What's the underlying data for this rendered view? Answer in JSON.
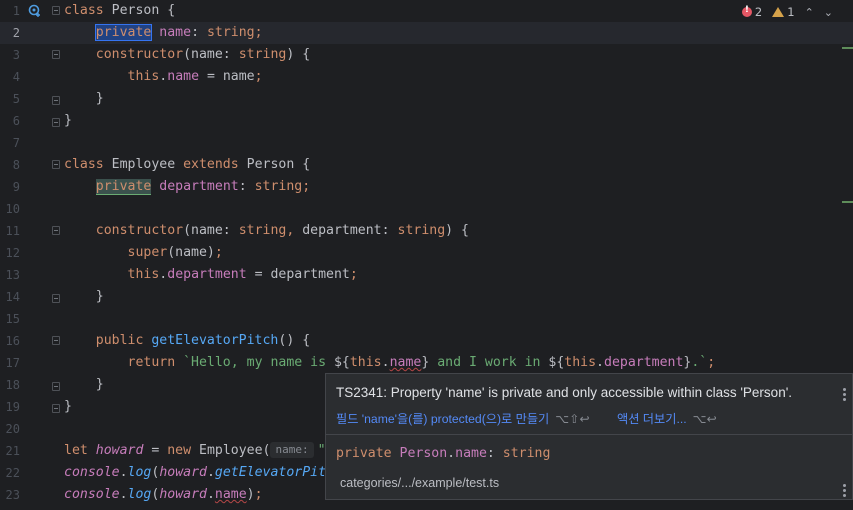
{
  "status": {
    "errors": "2",
    "warnings": "1"
  },
  "lines": [
    {
      "n": "1",
      "tokens": [
        [
          "kw",
          "class"
        ],
        [
          "tp",
          " Person {"
        ]
      ]
    },
    {
      "n": "2",
      "tokens": [
        [
          "tp",
          "    "
        ],
        [
          "sel",
          "private"
        ],
        [
          "kw",
          " "
        ],
        [
          "fld",
          "name"
        ],
        [
          "tp",
          ": "
        ],
        [
          "kw",
          "string"
        ],
        [
          "kw",
          ";"
        ]
      ]
    },
    {
      "n": "3",
      "tokens": [
        [
          "tp",
          "    "
        ],
        [
          "kw",
          "constructor"
        ],
        [
          "tp",
          "(name: "
        ],
        [
          "kw",
          "string"
        ],
        [
          "tp",
          ") {"
        ]
      ]
    },
    {
      "n": "4",
      "tokens": [
        [
          "tp",
          "        "
        ],
        [
          "kw",
          "this"
        ],
        [
          "tp",
          "."
        ],
        [
          "fld",
          "name"
        ],
        [
          "tp",
          " = name"
        ],
        [
          "kw",
          ";"
        ]
      ]
    },
    {
      "n": "5",
      "tokens": [
        [
          "tp",
          "    }"
        ]
      ]
    },
    {
      "n": "6",
      "tokens": [
        [
          "tp",
          "}"
        ]
      ]
    },
    {
      "n": "7",
      "tokens": []
    },
    {
      "n": "8",
      "tokens": [
        [
          "kw",
          "class"
        ],
        [
          "tp",
          " Employee "
        ],
        [
          "kw",
          "extends"
        ],
        [
          "tp",
          " Person {"
        ]
      ]
    },
    {
      "n": "9",
      "tokens": [
        [
          "tp",
          "    "
        ],
        [
          "warnbox",
          "private"
        ],
        [
          "kw",
          " "
        ],
        [
          "fld",
          "department"
        ],
        [
          "tp",
          ": "
        ],
        [
          "kw",
          "string"
        ],
        [
          "kw",
          ";"
        ]
      ]
    },
    {
      "n": "10",
      "tokens": []
    },
    {
      "n": "11",
      "tokens": [
        [
          "tp",
          "    "
        ],
        [
          "kw",
          "constructor"
        ],
        [
          "tp",
          "(name: "
        ],
        [
          "kw",
          "string"
        ],
        [
          "kw",
          ","
        ],
        [
          "tp",
          " department: "
        ],
        [
          "kw",
          "string"
        ],
        [
          "tp",
          ") {"
        ]
      ]
    },
    {
      "n": "12",
      "tokens": [
        [
          "tp",
          "        "
        ],
        [
          "kw",
          "super"
        ],
        [
          "tp",
          "(name)"
        ],
        [
          "kw",
          ";"
        ]
      ]
    },
    {
      "n": "13",
      "tokens": [
        [
          "tp",
          "        "
        ],
        [
          "kw",
          "this"
        ],
        [
          "tp",
          "."
        ],
        [
          "fld",
          "department"
        ],
        [
          "tp",
          " = department"
        ],
        [
          "kw",
          ";"
        ]
      ]
    },
    {
      "n": "14",
      "tokens": [
        [
          "tp",
          "    }"
        ]
      ]
    },
    {
      "n": "15",
      "tokens": []
    },
    {
      "n": "16",
      "tokens": [
        [
          "tp",
          "    "
        ],
        [
          "kw",
          "public "
        ],
        [
          "fn",
          "getElevatorPitch"
        ],
        [
          "tp",
          "() {"
        ]
      ]
    },
    {
      "n": "17",
      "tokens": [
        [
          "tp",
          "        "
        ],
        [
          "kw",
          "return "
        ],
        [
          "str",
          "`Hello, my name is "
        ],
        [
          "tp",
          "${"
        ],
        [
          "kw",
          "this"
        ],
        [
          "tp",
          "."
        ],
        [
          "fldw",
          "name"
        ],
        [
          "tp",
          "}"
        ],
        [
          "str",
          " and I work in "
        ],
        [
          "tp",
          "${"
        ],
        [
          "kw",
          "this"
        ],
        [
          "tp",
          "."
        ],
        [
          "fld",
          "department"
        ],
        [
          "tp",
          "}"
        ],
        [
          "str",
          ".`"
        ],
        [
          "kw",
          ";"
        ]
      ]
    },
    {
      "n": "18",
      "tokens": [
        [
          "tp",
          "    }"
        ]
      ]
    },
    {
      "n": "19",
      "tokens": [
        [
          "tp",
          "}"
        ]
      ]
    },
    {
      "n": "20",
      "tokens": []
    },
    {
      "n": "21",
      "tokens": [
        [
          "kw",
          "let "
        ],
        [
          "gn",
          "howard"
        ],
        [
          "tp",
          " = "
        ],
        [
          "kw",
          "new "
        ],
        [
          "tp",
          "Employee("
        ],
        [
          "hint",
          "name:"
        ],
        [
          "str",
          "\""
        ]
      ]
    },
    {
      "n": "22",
      "tokens": [
        [
          "gn",
          "console"
        ],
        [
          "tp",
          "."
        ],
        [
          "fnc",
          "log"
        ],
        [
          "tp",
          "("
        ],
        [
          "gn",
          "howard"
        ],
        [
          "tp",
          "."
        ],
        [
          "fnc",
          "getElevatorPitc"
        ]
      ]
    },
    {
      "n": "23",
      "tokens": [
        [
          "gn",
          "console"
        ],
        [
          "tp",
          "."
        ],
        [
          "fnc",
          "log"
        ],
        [
          "tp",
          "("
        ],
        [
          "gn",
          "howard"
        ],
        [
          "tp",
          "."
        ],
        [
          "fldw",
          "name"
        ],
        [
          "tp",
          ")"
        ],
        [
          "kw",
          ";"
        ]
      ]
    }
  ],
  "popup": {
    "message": "TS2341: Property 'name' is private and only accessible within class 'Person'.",
    "fix_label": "필드 'name'을(를) protected(으)로 만들기",
    "fix_shortcut": "⌥⇧↩",
    "more_label": "액션 더보기...",
    "more_shortcut": "⌥↩",
    "decl_kw": "private ",
    "decl_class": "Person",
    "decl_dot": ".",
    "decl_field": "name",
    "decl_rest": ": ",
    "decl_type": "string",
    "path": "categories/.../example/test.ts"
  }
}
